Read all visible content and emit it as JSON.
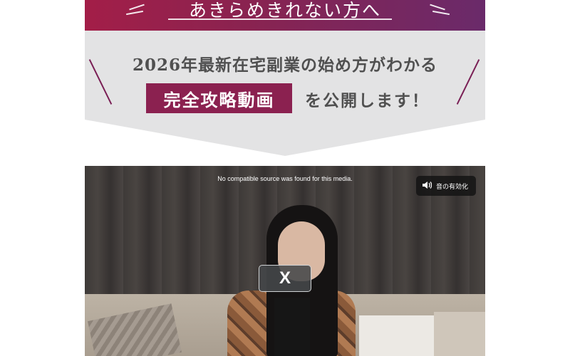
{
  "hero": {
    "title": "あきらめきれない方へ"
  },
  "band": {
    "line1": "2026年最新在宅副業の始め方がわかる",
    "badge": "完全攻略動画",
    "suffix": "を公開します！"
  },
  "video": {
    "notice": "No compatible source was found for this media.",
    "unmute_icon": "speaker-icon",
    "unmute_label": "音の有効化",
    "close_label": "X"
  },
  "colors": {
    "hero_start": "#a31e48",
    "hero_end": "#6a2a6a",
    "badge": "#8b2150",
    "band": "#e3e3e4"
  }
}
